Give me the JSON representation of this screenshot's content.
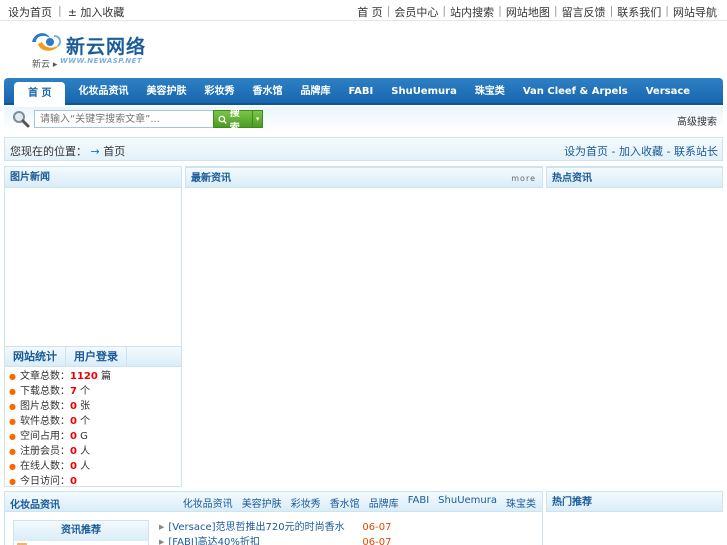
{
  "topbar": {
    "left": [
      "设为首页",
      "± 加入收藏"
    ],
    "right": [
      "首 页",
      "会员中心",
      "站内搜索",
      "网站地图",
      "留言反馈",
      "联系我们",
      "网站导航"
    ]
  },
  "logo": {
    "name": "新云网络",
    "subtitle": "新云 ▸",
    "url": "WWW.NEWASP.NET"
  },
  "nav": {
    "items": [
      "首 页",
      "化妆品资讯",
      "美容护肤",
      "彩妆秀",
      "香水馆",
      "品牌库",
      "FABI",
      "ShuUemura",
      "珠宝类",
      "Van Cleef & Arpels",
      "Versace"
    ]
  },
  "search": {
    "placeholder": "请输入“关键字搜索文章”...",
    "button_label": "搜索",
    "caret": "▾",
    "advanced_label": "高级搜索"
  },
  "breadcrumb": {
    "root": "您现在的位置：",
    "arrow": "→",
    "current": "首页",
    "links": "设为首页 - 加入收藏 - 联系站长"
  },
  "panels": {
    "left_title": "图片新闻",
    "mid_title": "最新资讯",
    "mid_more": "more",
    "right_title": "热点资讯"
  },
  "left_tabs": [
    "网站统计",
    "用户登录"
  ],
  "stats": [
    {
      "label": "文章总数：",
      "value": "1120",
      "unit": "篇"
    },
    {
      "label": "下载总数：",
      "value": "7",
      "unit": "个"
    },
    {
      "label": "图片总数：",
      "value": "0",
      "unit": "张"
    },
    {
      "label": "软件总数：",
      "value": "0",
      "unit": "个"
    },
    {
      "label": "空间占用：",
      "value": "0",
      "unit": "G"
    },
    {
      "label": "注册会员：",
      "value": "0",
      "unit": "人"
    },
    {
      "label": "在线人数：",
      "value": "0",
      "unit": "人"
    },
    {
      "label": "今日访问：",
      "value": "0",
      "unit": ""
    }
  ],
  "bottom": {
    "title": "化妆品资讯",
    "cats": [
      "化妆品资讯",
      "美容护肤",
      "彩妆秀",
      "香水馆",
      "品牌库",
      "FABI",
      "ShuUemura",
      "珠宝类"
    ],
    "subbox_title": "资讯推荐",
    "news": [
      {
        "title": "[Versace]范思哲推出720元的时尚香水",
        "date": "06-07"
      },
      {
        "title": "[FABI]高达40%折扣",
        "date": "06-07"
      }
    ],
    "right_title": "热门推荐"
  },
  "colors": {
    "nav_blue": "#1566ae",
    "link_blue": "#1a5a99",
    "number_red": "#ee0000",
    "date_orange": "#e34a00",
    "search_green": "#4b9c22"
  }
}
